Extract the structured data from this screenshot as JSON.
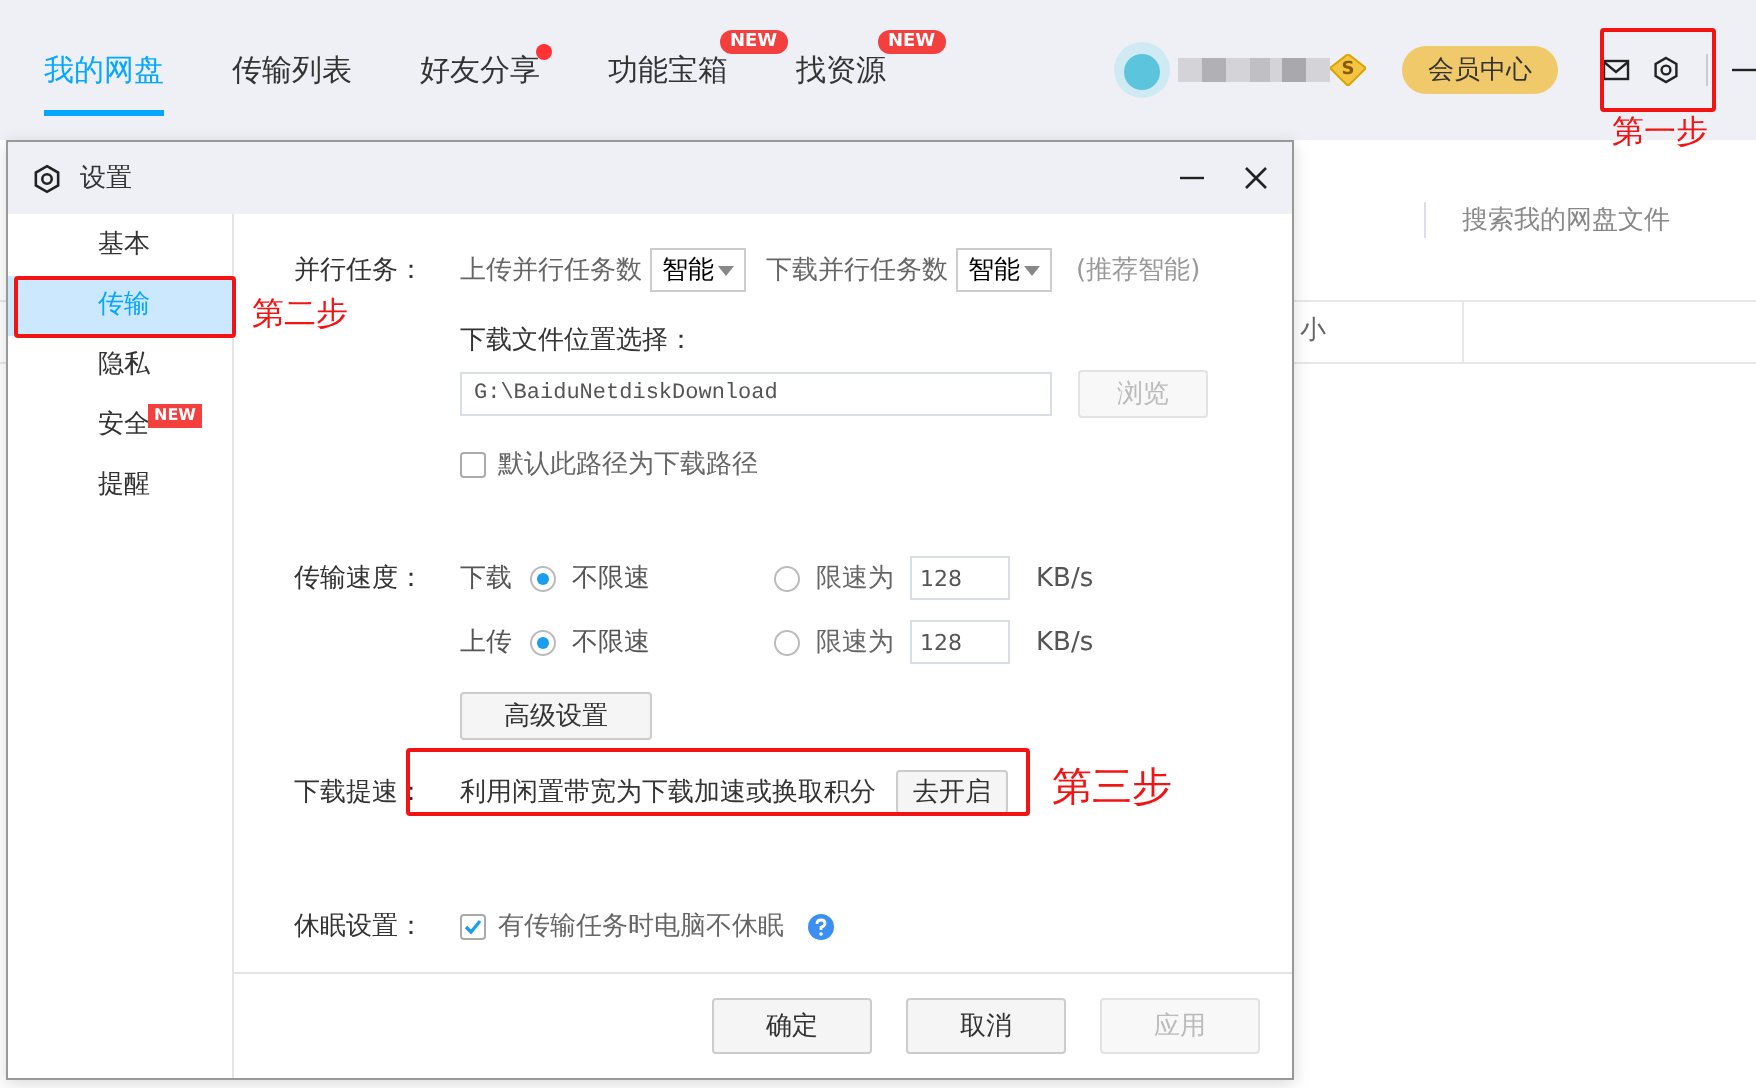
{
  "top_tabs": [
    {
      "label": "我的网盘",
      "selected": true,
      "dot": false
    },
    {
      "label": "传输列表",
      "selected": false,
      "dot": false
    },
    {
      "label": "好友分享",
      "selected": false,
      "dot": true
    },
    {
      "label": "功能宝箱",
      "selected": false,
      "dot": false,
      "badge": "NEW"
    },
    {
      "label": "找资源",
      "selected": false,
      "dot": false,
      "badge": "NEW"
    }
  ],
  "user": {
    "vip_badge": "S"
  },
  "member_button": "会员中心",
  "background": {
    "search_placeholder": "搜索我的网盘文件",
    "column_fragment": "小"
  },
  "dialog": {
    "title": "设置",
    "nav": [
      {
        "label": "基本",
        "selected": false
      },
      {
        "label": "传输",
        "selected": true
      },
      {
        "label": "隐私",
        "selected": false
      },
      {
        "label": "安全",
        "selected": false,
        "badge": "NEW"
      },
      {
        "label": "提醒",
        "selected": false
      }
    ],
    "parallel": {
      "label": "并行任务：",
      "upload_label": "上传并行任务数",
      "upload_value": "智能",
      "download_label": "下载并行任务数",
      "download_value": "智能",
      "hint": "(推荐智能)"
    },
    "location": {
      "label": "下载文件位置选择：",
      "path": "G:\\BaiduNetdiskDownload",
      "browse": "浏览",
      "browse_disabled": true,
      "default_checkbox": {
        "label": "默认此路径为下载路径",
        "checked": false
      }
    },
    "speed": {
      "label": "传输速度：",
      "rows": [
        {
          "direction": "下载",
          "unlimited_label": "不限速",
          "unlimited": true,
          "limit_label": "限速为",
          "limit_value": "128",
          "unit": "KB/s"
        },
        {
          "direction": "上传",
          "unlimited_label": "不限速",
          "unlimited": true,
          "limit_label": "限速为",
          "limit_value": "128",
          "unit": "KB/s"
        }
      ],
      "advanced_button": "高级设置"
    },
    "boost": {
      "label": "下载提速：",
      "text": "利用闲置带宽为下载加速或换取积分",
      "button": "去开启"
    },
    "sleep": {
      "label": "休眠设置：",
      "checkbox": {
        "label": "有传输任务时电脑不休眠",
        "checked": true
      }
    },
    "footer": [
      {
        "label": "确定",
        "disabled": false
      },
      {
        "label": "取消",
        "disabled": false
      },
      {
        "label": "应用",
        "disabled": true
      }
    ]
  },
  "annotations": [
    {
      "label": "第一步"
    },
    {
      "label": "第二步"
    },
    {
      "label": "第三步"
    }
  ]
}
